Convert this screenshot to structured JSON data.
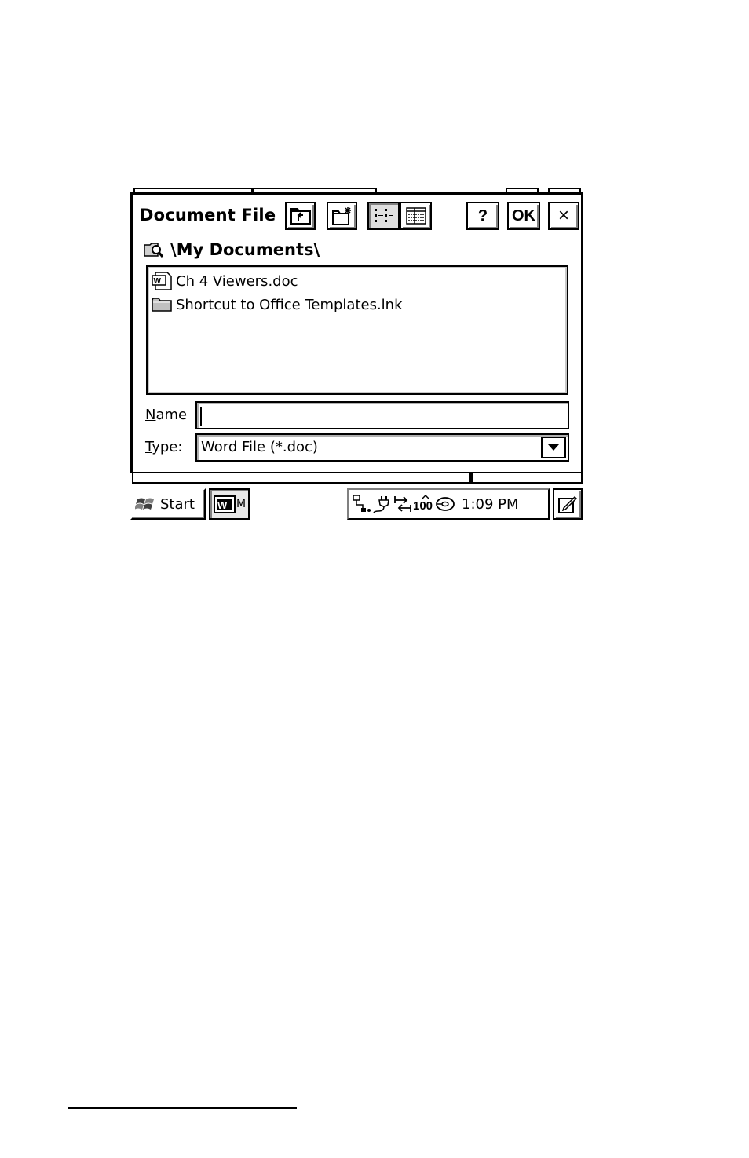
{
  "dialog": {
    "title": "Document File",
    "ok_label": "OK",
    "help_label": "?",
    "close_label": "×",
    "path": "\\My Documents\\"
  },
  "files": [
    {
      "name": "Ch 4 Viewers.doc",
      "icon": "word-document-icon"
    },
    {
      "name": "Shortcut to Office Templates.lnk",
      "icon": "folder-icon"
    }
  ],
  "form": {
    "name_label_accel": "N",
    "name_label_rest": "ame",
    "name_value": "",
    "type_label_accel": "T",
    "type_label_rest": "ype:",
    "type_value": "Word File (*.doc)"
  },
  "taskbar": {
    "start_label": "Start",
    "app_label": "M",
    "clock": "1:09 PM"
  }
}
